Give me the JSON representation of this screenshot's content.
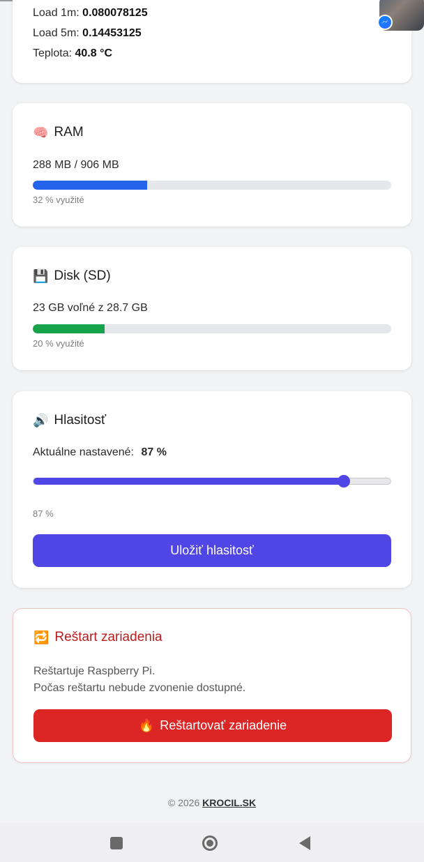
{
  "cpu": {
    "load1_label": "Load 1m:",
    "load1_value": "0.080078125",
    "load5_label": "Load 5m:",
    "load5_value": "0.14453125",
    "temp_label": "Teplota:",
    "temp_value": "40.8 °C"
  },
  "ram": {
    "emoji": "🧠",
    "title": "RAM",
    "usage_text": "288 MB / 906 MB",
    "percent_used": 32,
    "bar_color": "#2563eb",
    "hint": "32 % využité"
  },
  "disk": {
    "emoji": "💾",
    "title": "Disk (SD)",
    "usage_text": "23 GB voľné z 28.7 GB",
    "percent_used": 20,
    "bar_color": "#16a34a",
    "hint": "20 % využité"
  },
  "volume": {
    "emoji": "🔊",
    "title": "Hlasitosť",
    "current_label": "Aktuálne nastavené:",
    "current_value": "87 %",
    "slider_value": 87,
    "slider_readout": "87 %",
    "save_button": "Uložiť hlasitosť",
    "accent_color": "#4f46e5"
  },
  "restart": {
    "emoji": "🔁",
    "title": "Reštart zariadenia",
    "desc_line1": "Reštartuje Raspberry Pi.",
    "desc_line2": "Počas reštartu nebude zvonenie dostupné.",
    "button_emoji": "🔥",
    "button_label": "Reštartovať zariadenie",
    "accent_color": "#dc2626"
  },
  "footer": {
    "copyright": "© 2026",
    "link": "KROCIL.SK"
  },
  "overlay": {
    "chathead_icon": "messenger-icon"
  },
  "navbar": {
    "recents_icon": "square-icon",
    "home_icon": "circle-home-icon",
    "back_icon": "triangle-back-icon"
  }
}
